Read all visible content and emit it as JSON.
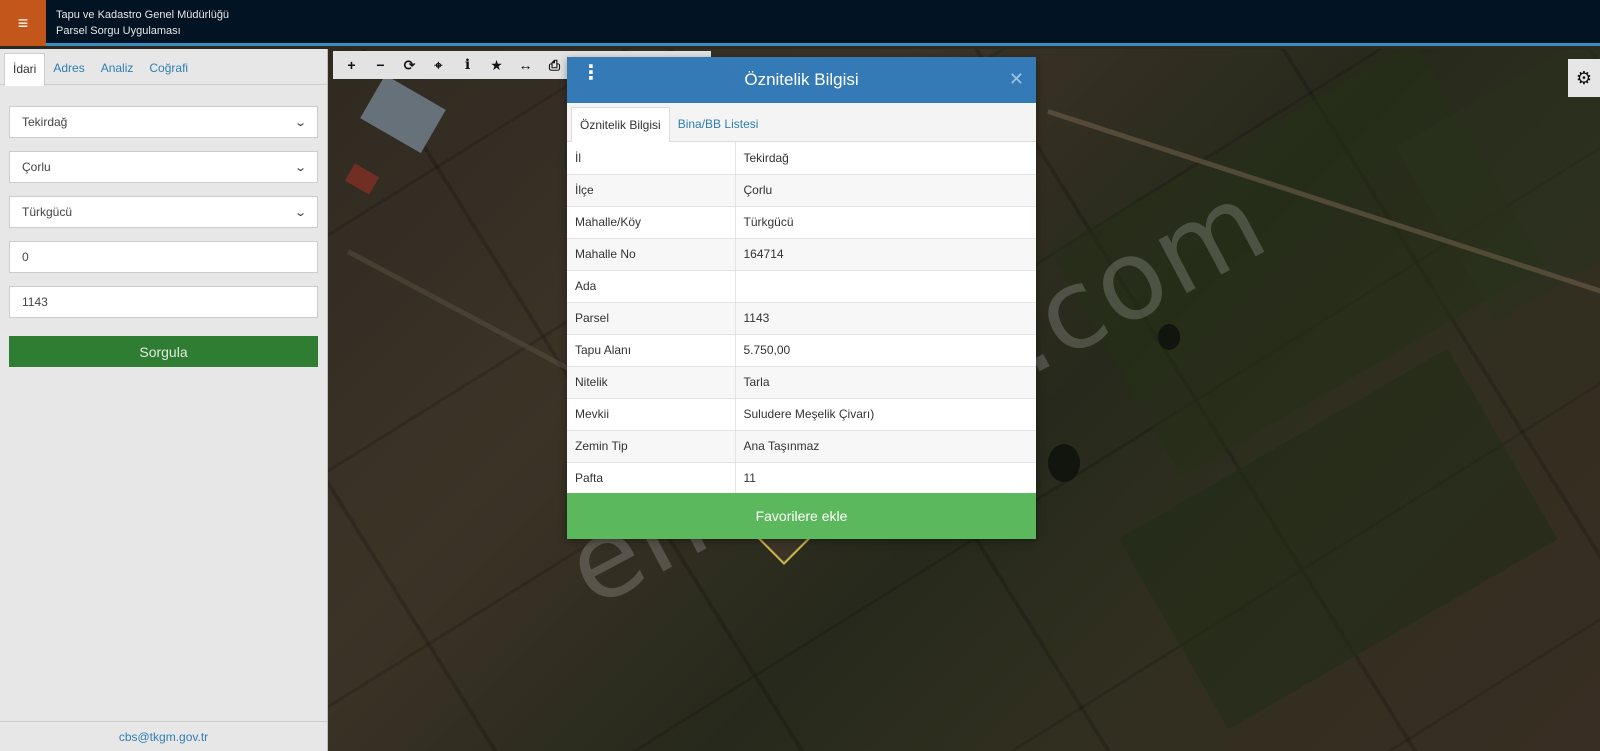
{
  "header": {
    "title_line1": "Tapu ve Kadastro Genel Müdürlüğü",
    "title_line2": "Parsel Sorgu Uygulaması",
    "menu_icon": "hamburger-icon"
  },
  "sidebar": {
    "tabs": [
      {
        "label": "İdari",
        "active": true
      },
      {
        "label": "Adres",
        "active": false
      },
      {
        "label": "Analiz",
        "active": false
      },
      {
        "label": "Coğrafi",
        "active": false
      }
    ],
    "il": "Tekirdağ",
    "ilce": "Çorlu",
    "mahalle": "Türkgücü",
    "ada": "0",
    "parsel": "1143",
    "query_button": "Sorgula",
    "footer_email": "cbs@tkgm.gov.tr"
  },
  "map": {
    "watermark": "emlakjet.com",
    "toolbar_icons": [
      "zoom-in-icon",
      "zoom-out-icon",
      "refresh-icon",
      "locate-icon",
      "info-icon",
      "star-icon",
      "measure-icon",
      "print-icon"
    ],
    "settings_icon": "gear-icon"
  },
  "modal": {
    "title": "Öznitelik Bilgisi",
    "tabs": [
      "Öznitelik Bilgisi",
      "Bina/BB Listesi"
    ],
    "rows": [
      {
        "key": "İl",
        "value": "Tekirdağ"
      },
      {
        "key": "İlçe",
        "value": "Çorlu"
      },
      {
        "key": "Mahalle/Köy",
        "value": "Türkgücü"
      },
      {
        "key": "Mahalle No",
        "value": "164714"
      },
      {
        "key": "Ada",
        "value": ""
      },
      {
        "key": "Parsel",
        "value": "1143"
      },
      {
        "key": "Tapu Alanı",
        "value": "5.750,00"
      },
      {
        "key": "Nitelik",
        "value": "Tarla"
      },
      {
        "key": "Mevkii",
        "value": "Suludere Meşelik Çivarı)"
      },
      {
        "key": "Zemin Tip",
        "value": "Ana Taşınmaz"
      },
      {
        "key": "Pafta",
        "value": "11"
      }
    ],
    "favorite_button": "Favorilere ekle"
  },
  "colors": {
    "header_bg": "#021424",
    "menu_accent": "#c2561b",
    "modal_header": "#337ab7",
    "favorite_green": "#5cb85c",
    "query_green": "#2f7d32"
  }
}
